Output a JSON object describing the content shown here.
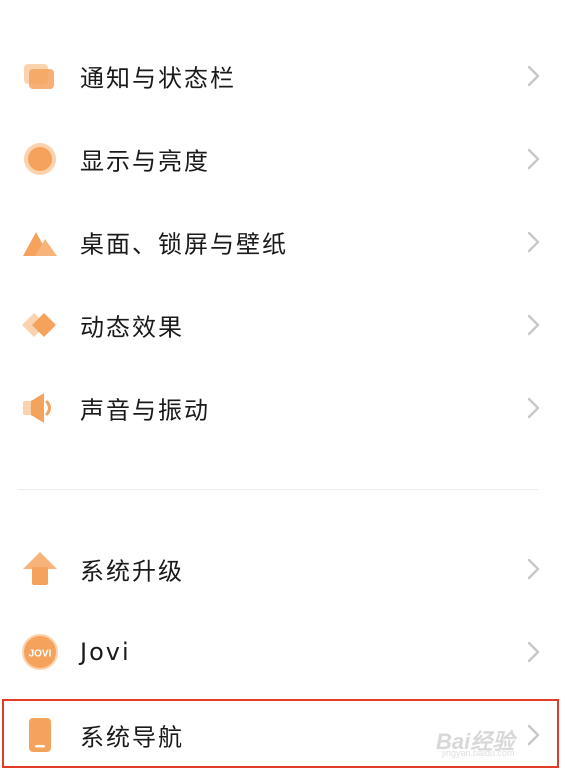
{
  "colors": {
    "accent": "#F5A25D",
    "accent_light": "#FAD3AE",
    "chevron": "#C8C8C8",
    "divider": "#ECECEC",
    "highlight_border": "#E23B26"
  },
  "settings": {
    "group1": [
      {
        "label": "通知与状态栏",
        "icon": "notification-icon"
      },
      {
        "label": "显示与亮度",
        "icon": "brightness-icon"
      },
      {
        "label": "桌面、锁屏与壁纸",
        "icon": "wallpaper-icon"
      },
      {
        "label": "动态效果",
        "icon": "animation-icon"
      },
      {
        "label": "声音与振动",
        "icon": "speaker-icon"
      }
    ],
    "group2": [
      {
        "label": "系统升级",
        "icon": "upgrade-arrow-icon"
      },
      {
        "label": "Jovi",
        "icon": "jovi-logo-icon",
        "icon_text": "JOVI"
      },
      {
        "label": "系统导航",
        "icon": "phone-navigation-icon",
        "highlighted": true
      }
    ]
  },
  "watermark": {
    "text": "Bai经验",
    "sub": "jingyan.baidu.com"
  }
}
